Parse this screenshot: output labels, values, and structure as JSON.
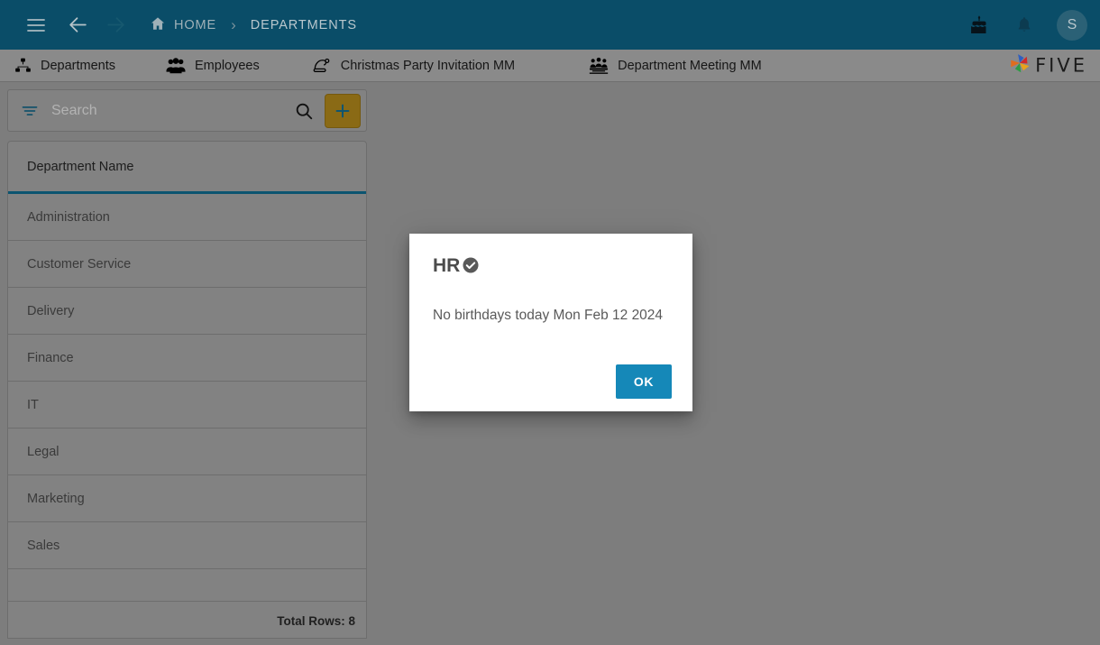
{
  "appbar": {
    "menu_label": "Menu",
    "back_label": "Back",
    "forward_label": "Forward",
    "breadcrumbs": [
      {
        "label": "HOME",
        "icon": "home-icon"
      },
      {
        "label": "DEPARTMENTS",
        "icon": ""
      }
    ],
    "separator": "›",
    "cake_label": "Birthdays",
    "bell_label": "Notifications",
    "avatar_initial": "S",
    "bg_color": "#0a4d68"
  },
  "tabbar": {
    "tabs": [
      {
        "label": "Departments",
        "icon": "sitemap-icon"
      },
      {
        "label": "Employees",
        "icon": "users-icon"
      },
      {
        "label": "Christmas Party Invitation MM",
        "icon": "santa-hat-icon"
      },
      {
        "label": "Department Meeting MM",
        "icon": "meeting-icon"
      }
    ],
    "brand": "FIVE"
  },
  "search": {
    "placeholder": "Search",
    "value": "",
    "filter_icon": "filter-icon",
    "search_icon": "search-icon",
    "add_label": "+",
    "add_color": "#8a6a15"
  },
  "list": {
    "column_header": "Department Name",
    "rows": [
      "Administration",
      "Customer Service",
      "Delivery",
      "Finance",
      "IT",
      "Legal",
      "Marketing",
      "Sales"
    ],
    "footer": "Total Rows: 8"
  },
  "dialog": {
    "title": "HR",
    "title_icon": "check-circle-icon",
    "message": "No birthdays today Mon Feb 12 2024",
    "ok_label": "OK",
    "ok_color": "#1588b8"
  }
}
